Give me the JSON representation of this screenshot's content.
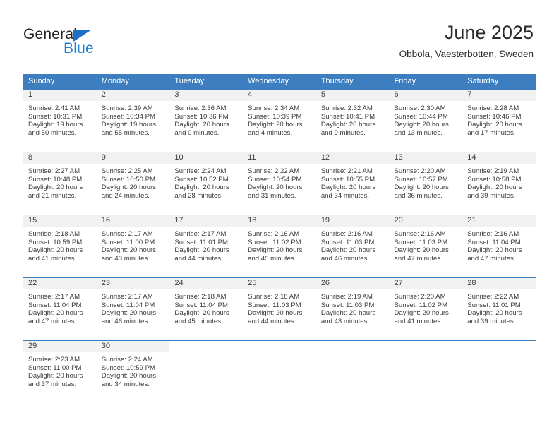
{
  "brand": {
    "name_part1": "General",
    "name_part2": "Blue",
    "triangle_color": "#1f6fc4",
    "blue_color": "#1f7fd4"
  },
  "header": {
    "title": "June 2025",
    "subtitle": "Obbola, Vaesterbotten, Sweden"
  },
  "theme": {
    "header_row_bg": "#3c7ebf",
    "daynum_bg": "#f1f1f1",
    "text_color": "#3b3b3b"
  },
  "labels": {
    "sunrise_prefix": "Sunrise:",
    "sunset_prefix": "Sunset:",
    "daylight_prefix": "Daylight:"
  },
  "weekdays": [
    "Sunday",
    "Monday",
    "Tuesday",
    "Wednesday",
    "Thursday",
    "Friday",
    "Saturday"
  ],
  "weeks": [
    [
      {
        "day": "1",
        "sunrise": "Sunrise: 2:41 AM",
        "sunset": "Sunset: 10:31 PM",
        "daylight_line1": "Daylight: 19 hours",
        "daylight_line2": "and 50 minutes."
      },
      {
        "day": "2",
        "sunrise": "Sunrise: 2:39 AM",
        "sunset": "Sunset: 10:34 PM",
        "daylight_line1": "Daylight: 19 hours",
        "daylight_line2": "and 55 minutes."
      },
      {
        "day": "3",
        "sunrise": "Sunrise: 2:36 AM",
        "sunset": "Sunset: 10:36 PM",
        "daylight_line1": "Daylight: 20 hours",
        "daylight_line2": "and 0 minutes."
      },
      {
        "day": "4",
        "sunrise": "Sunrise: 2:34 AM",
        "sunset": "Sunset: 10:39 PM",
        "daylight_line1": "Daylight: 20 hours",
        "daylight_line2": "and 4 minutes."
      },
      {
        "day": "5",
        "sunrise": "Sunrise: 2:32 AM",
        "sunset": "Sunset: 10:41 PM",
        "daylight_line1": "Daylight: 20 hours",
        "daylight_line2": "and 9 minutes."
      },
      {
        "day": "6",
        "sunrise": "Sunrise: 2:30 AM",
        "sunset": "Sunset: 10:44 PM",
        "daylight_line1": "Daylight: 20 hours",
        "daylight_line2": "and 13 minutes."
      },
      {
        "day": "7",
        "sunrise": "Sunrise: 2:28 AM",
        "sunset": "Sunset: 10:46 PM",
        "daylight_line1": "Daylight: 20 hours",
        "daylight_line2": "and 17 minutes."
      }
    ],
    [
      {
        "day": "8",
        "sunrise": "Sunrise: 2:27 AM",
        "sunset": "Sunset: 10:48 PM",
        "daylight_line1": "Daylight: 20 hours",
        "daylight_line2": "and 21 minutes."
      },
      {
        "day": "9",
        "sunrise": "Sunrise: 2:25 AM",
        "sunset": "Sunset: 10:50 PM",
        "daylight_line1": "Daylight: 20 hours",
        "daylight_line2": "and 24 minutes."
      },
      {
        "day": "10",
        "sunrise": "Sunrise: 2:24 AM",
        "sunset": "Sunset: 10:52 PM",
        "daylight_line1": "Daylight: 20 hours",
        "daylight_line2": "and 28 minutes."
      },
      {
        "day": "11",
        "sunrise": "Sunrise: 2:22 AM",
        "sunset": "Sunset: 10:54 PM",
        "daylight_line1": "Daylight: 20 hours",
        "daylight_line2": "and 31 minutes."
      },
      {
        "day": "12",
        "sunrise": "Sunrise: 2:21 AM",
        "sunset": "Sunset: 10:55 PM",
        "daylight_line1": "Daylight: 20 hours",
        "daylight_line2": "and 34 minutes."
      },
      {
        "day": "13",
        "sunrise": "Sunrise: 2:20 AM",
        "sunset": "Sunset: 10:57 PM",
        "daylight_line1": "Daylight: 20 hours",
        "daylight_line2": "and 36 minutes."
      },
      {
        "day": "14",
        "sunrise": "Sunrise: 2:19 AM",
        "sunset": "Sunset: 10:58 PM",
        "daylight_line1": "Daylight: 20 hours",
        "daylight_line2": "and 39 minutes."
      }
    ],
    [
      {
        "day": "15",
        "sunrise": "Sunrise: 2:18 AM",
        "sunset": "Sunset: 10:59 PM",
        "daylight_line1": "Daylight: 20 hours",
        "daylight_line2": "and 41 minutes."
      },
      {
        "day": "16",
        "sunrise": "Sunrise: 2:17 AM",
        "sunset": "Sunset: 11:00 PM",
        "daylight_line1": "Daylight: 20 hours",
        "daylight_line2": "and 43 minutes."
      },
      {
        "day": "17",
        "sunrise": "Sunrise: 2:17 AM",
        "sunset": "Sunset: 11:01 PM",
        "daylight_line1": "Daylight: 20 hours",
        "daylight_line2": "and 44 minutes."
      },
      {
        "day": "18",
        "sunrise": "Sunrise: 2:16 AM",
        "sunset": "Sunset: 11:02 PM",
        "daylight_line1": "Daylight: 20 hours",
        "daylight_line2": "and 45 minutes."
      },
      {
        "day": "19",
        "sunrise": "Sunrise: 2:16 AM",
        "sunset": "Sunset: 11:03 PM",
        "daylight_line1": "Daylight: 20 hours",
        "daylight_line2": "and 46 minutes."
      },
      {
        "day": "20",
        "sunrise": "Sunrise: 2:16 AM",
        "sunset": "Sunset: 11:03 PM",
        "daylight_line1": "Daylight: 20 hours",
        "daylight_line2": "and 47 minutes."
      },
      {
        "day": "21",
        "sunrise": "Sunrise: 2:16 AM",
        "sunset": "Sunset: 11:04 PM",
        "daylight_line1": "Daylight: 20 hours",
        "daylight_line2": "and 47 minutes."
      }
    ],
    [
      {
        "day": "22",
        "sunrise": "Sunrise: 2:17 AM",
        "sunset": "Sunset: 11:04 PM",
        "daylight_line1": "Daylight: 20 hours",
        "daylight_line2": "and 47 minutes."
      },
      {
        "day": "23",
        "sunrise": "Sunrise: 2:17 AM",
        "sunset": "Sunset: 11:04 PM",
        "daylight_line1": "Daylight: 20 hours",
        "daylight_line2": "and 46 minutes."
      },
      {
        "day": "24",
        "sunrise": "Sunrise: 2:18 AM",
        "sunset": "Sunset: 11:04 PM",
        "daylight_line1": "Daylight: 20 hours",
        "daylight_line2": "and 45 minutes."
      },
      {
        "day": "25",
        "sunrise": "Sunrise: 2:18 AM",
        "sunset": "Sunset: 11:03 PM",
        "daylight_line1": "Daylight: 20 hours",
        "daylight_line2": "and 44 minutes."
      },
      {
        "day": "26",
        "sunrise": "Sunrise: 2:19 AM",
        "sunset": "Sunset: 11:03 PM",
        "daylight_line1": "Daylight: 20 hours",
        "daylight_line2": "and 43 minutes."
      },
      {
        "day": "27",
        "sunrise": "Sunrise: 2:20 AM",
        "sunset": "Sunset: 11:02 PM",
        "daylight_line1": "Daylight: 20 hours",
        "daylight_line2": "and 41 minutes."
      },
      {
        "day": "28",
        "sunrise": "Sunrise: 2:22 AM",
        "sunset": "Sunset: 11:01 PM",
        "daylight_line1": "Daylight: 20 hours",
        "daylight_line2": "and 39 minutes."
      }
    ],
    [
      {
        "day": "29",
        "sunrise": "Sunrise: 2:23 AM",
        "sunset": "Sunset: 11:00 PM",
        "daylight_line1": "Daylight: 20 hours",
        "daylight_line2": "and 37 minutes."
      },
      {
        "day": "30",
        "sunrise": "Sunrise: 2:24 AM",
        "sunset": "Sunset: 10:59 PM",
        "daylight_line1": "Daylight: 20 hours",
        "daylight_line2": "and 34 minutes."
      },
      {
        "day": "",
        "sunrise": "",
        "sunset": "",
        "daylight_line1": "",
        "daylight_line2": ""
      },
      {
        "day": "",
        "sunrise": "",
        "sunset": "",
        "daylight_line1": "",
        "daylight_line2": ""
      },
      {
        "day": "",
        "sunrise": "",
        "sunset": "",
        "daylight_line1": "",
        "daylight_line2": ""
      },
      {
        "day": "",
        "sunrise": "",
        "sunset": "",
        "daylight_line1": "",
        "daylight_line2": ""
      },
      {
        "day": "",
        "sunrise": "",
        "sunset": "",
        "daylight_line1": "",
        "daylight_line2": ""
      }
    ]
  ]
}
